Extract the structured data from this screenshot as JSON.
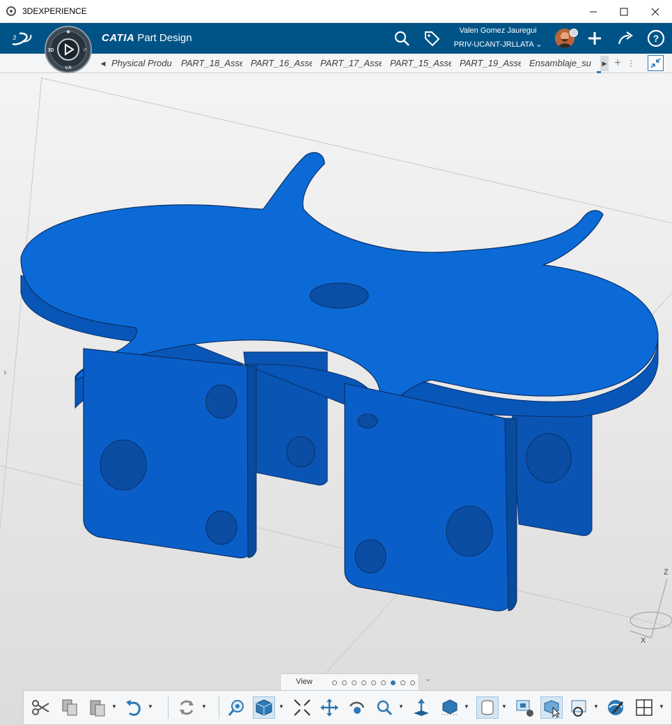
{
  "window": {
    "title": "3DEXPERIENCE",
    "controls": [
      "minimize",
      "maximize",
      "close"
    ]
  },
  "header": {
    "brand": "CATIA",
    "app_name": "Part Design",
    "user_name": "Valen Gomez Jauregui",
    "tenant": "PRIV-UCANT-JRLLATA",
    "compass": {
      "top": "3D",
      "left": "3D",
      "right": "i³",
      "bottom": "V.R"
    },
    "icons": [
      "search-icon",
      "tag-icon",
      "avatar",
      "add-icon",
      "share-icon",
      "help-icon"
    ]
  },
  "tabs": [
    {
      "label": "Physical Produ"
    },
    {
      "label": "PART_18_Asse"
    },
    {
      "label": "PART_16_Asse"
    },
    {
      "label": "PART_17_Asse"
    },
    {
      "label": "PART_15_Asse"
    },
    {
      "label": "PART_19_Asse"
    },
    {
      "label": "Ensamblaje_su"
    }
  ],
  "viewport": {
    "part_color": "#0b6ad6",
    "part_side_color": "#0a55b4",
    "axis_labels": {
      "z": "Z",
      "x": "X"
    }
  },
  "action_bar": {
    "section_label": "View",
    "sections_count": 9,
    "active_section": 7,
    "tools": [
      "cut",
      "copy",
      "paste",
      "undo",
      "update",
      "fly-mode",
      "view-mode",
      "fit-all",
      "pan",
      "rotate",
      "zoom",
      "normal-view",
      "ground",
      "visualization-mode",
      "hide-show",
      "properties",
      "clipping-box",
      "tree-reordering",
      "view-settings"
    ]
  },
  "colors": {
    "header_bg": "#005386",
    "viewport_bg": "#e3e4e5",
    "accent": "#0b6ad6"
  }
}
